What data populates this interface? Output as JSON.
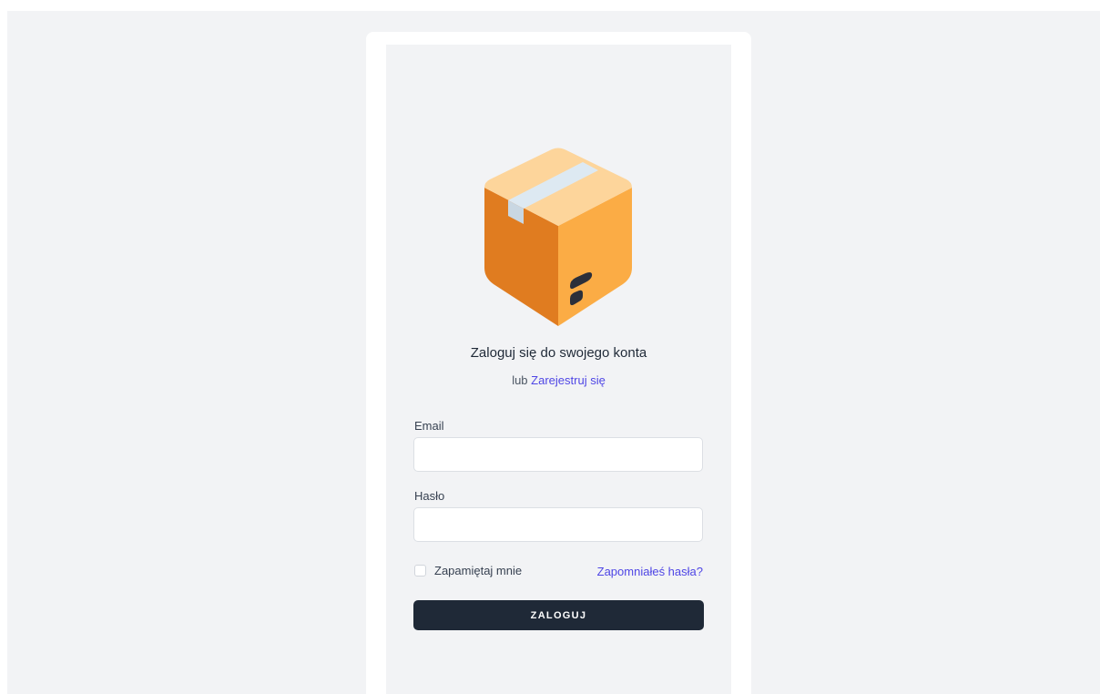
{
  "login": {
    "heading": "Zaloguj się do swojego konta",
    "subline_prefix": "lub",
    "register_link": "Zarejestruj się",
    "email_label": "Email",
    "email_value": "",
    "password_label": "Hasło",
    "password_value": "",
    "remember_label": "Zapamiętaj mnie",
    "remember_checked": false,
    "forgot_link": "Zapomniałeś hasła?",
    "submit_label": "ZALOGUJ"
  },
  "logo": {
    "icon": "package-box-icon",
    "colors": {
      "box_left": "#e07c20",
      "box_right": "#fbac45",
      "box_top": "#fdd59b",
      "tape": "#dde9f2",
      "mark": "#2b2f3a"
    }
  },
  "colors": {
    "background": "#f2f3f5",
    "card": "#ffffff",
    "accent_link": "#4f46e5",
    "button": "#1f2937"
  }
}
